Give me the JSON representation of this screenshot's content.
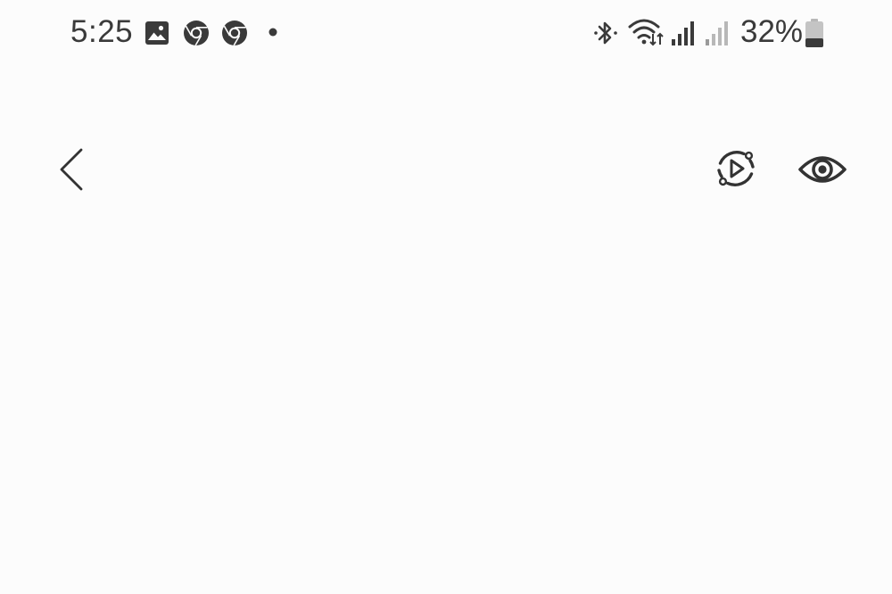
{
  "status_bar": {
    "time": "5:25",
    "battery_percent": "32%",
    "left_icons": [
      "gallery-notification-icon",
      "chrome-notification-icon",
      "chrome-notification-icon",
      "more-notifications-dot-icon"
    ],
    "right_icons": [
      "bluetooth-icon",
      "wifi-icon",
      "signal-strength-icon",
      "signal-strength-secondary-icon",
      "battery-icon"
    ],
    "battery_level": 0.32
  },
  "app_bar": {
    "left_icons": [
      "back-arrow-icon"
    ],
    "right_icons": [
      "motion-playback-icon",
      "view-eye-icon"
    ]
  },
  "colors": {
    "background": "#fcfcfc",
    "icon": "#333333",
    "dim_signal": "#b8b8b8"
  }
}
